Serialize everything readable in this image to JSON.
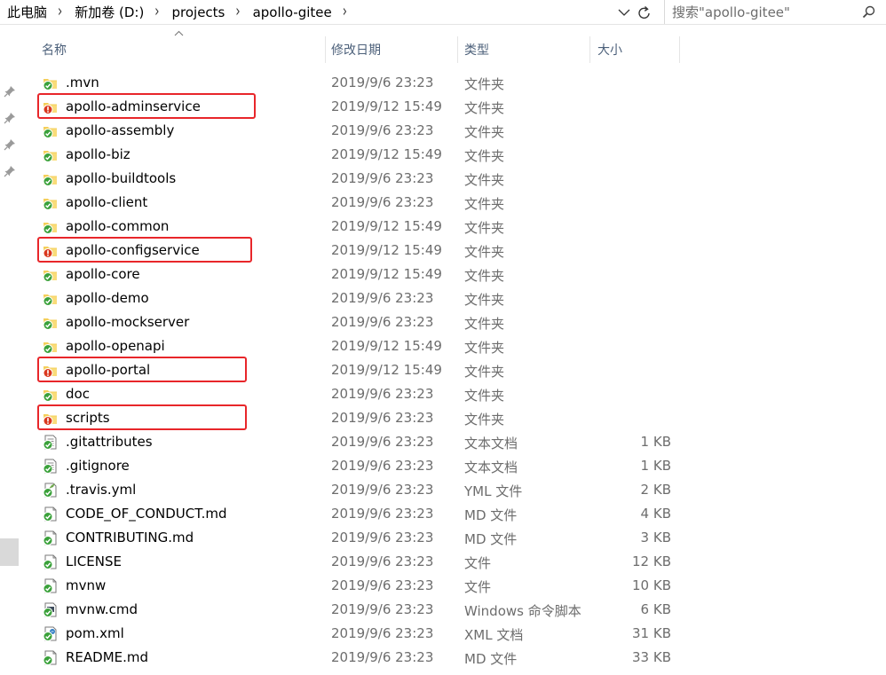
{
  "breadcrumb": [
    "此电脑",
    "新加卷 (D:)",
    "projects",
    "apollo-gitee"
  ],
  "search": {
    "placeholder": "搜索\"apollo-gitee\""
  },
  "columns": {
    "name": "名称",
    "date": "修改日期",
    "type": "类型",
    "size": "大小"
  },
  "colors": {
    "highlight": "#e8262a",
    "conflict": "#d9381e",
    "ok": "#3aa13a",
    "header_text": "#4c607a"
  },
  "rows": [
    {
      "name": ".mvn",
      "date": "2019/9/6 23:23",
      "type": "文件夹",
      "size": "",
      "kind": "folder",
      "status": "ok",
      "highlight": false
    },
    {
      "name": "apollo-adminservice",
      "date": "2019/9/12 15:49",
      "type": "文件夹",
      "size": "",
      "kind": "folder",
      "status": "modified",
      "highlight": true
    },
    {
      "name": "apollo-assembly",
      "date": "2019/9/6 23:23",
      "type": "文件夹",
      "size": "",
      "kind": "folder",
      "status": "ok",
      "highlight": false
    },
    {
      "name": "apollo-biz",
      "date": "2019/9/12 15:49",
      "type": "文件夹",
      "size": "",
      "kind": "folder",
      "status": "ok",
      "highlight": false
    },
    {
      "name": "apollo-buildtools",
      "date": "2019/9/6 23:23",
      "type": "文件夹",
      "size": "",
      "kind": "folder",
      "status": "ok",
      "highlight": false
    },
    {
      "name": "apollo-client",
      "date": "2019/9/6 23:23",
      "type": "文件夹",
      "size": "",
      "kind": "folder",
      "status": "ok",
      "highlight": false
    },
    {
      "name": "apollo-common",
      "date": "2019/9/12 15:49",
      "type": "文件夹",
      "size": "",
      "kind": "folder",
      "status": "ok",
      "highlight": false
    },
    {
      "name": "apollo-configservice",
      "date": "2019/9/12 15:49",
      "type": "文件夹",
      "size": "",
      "kind": "folder",
      "status": "modified",
      "highlight": true
    },
    {
      "name": "apollo-core",
      "date": "2019/9/12 15:49",
      "type": "文件夹",
      "size": "",
      "kind": "folder",
      "status": "ok",
      "highlight": false
    },
    {
      "name": "apollo-demo",
      "date": "2019/9/6 23:23",
      "type": "文件夹",
      "size": "",
      "kind": "folder",
      "status": "ok",
      "highlight": false
    },
    {
      "name": "apollo-mockserver",
      "date": "2019/9/6 23:23",
      "type": "文件夹",
      "size": "",
      "kind": "folder",
      "status": "ok",
      "highlight": false
    },
    {
      "name": "apollo-openapi",
      "date": "2019/9/12 15:49",
      "type": "文件夹",
      "size": "",
      "kind": "folder",
      "status": "ok",
      "highlight": false
    },
    {
      "name": "apollo-portal",
      "date": "2019/9/12 15:49",
      "type": "文件夹",
      "size": "",
      "kind": "folder",
      "status": "modified",
      "highlight": true
    },
    {
      "name": "doc",
      "date": "2019/9/6 23:23",
      "type": "文件夹",
      "size": "",
      "kind": "folder",
      "status": "ok",
      "highlight": false
    },
    {
      "name": "scripts",
      "date": "2019/9/6 23:23",
      "type": "文件夹",
      "size": "",
      "kind": "folder",
      "status": "modified",
      "highlight": true
    },
    {
      "name": ".gitattributes",
      "date": "2019/9/6 23:23",
      "type": "文本文档",
      "size": "1 KB",
      "kind": "text",
      "status": "ok",
      "highlight": false
    },
    {
      "name": ".gitignore",
      "date": "2019/9/6 23:23",
      "type": "文本文档",
      "size": "1 KB",
      "kind": "text",
      "status": "ok",
      "highlight": false
    },
    {
      "name": ".travis.yml",
      "date": "2019/9/6 23:23",
      "type": "YML 文件",
      "size": "2 KB",
      "kind": "yml",
      "status": "ok",
      "highlight": false
    },
    {
      "name": "CODE_OF_CONDUCT.md",
      "date": "2019/9/6 23:23",
      "type": "MD 文件",
      "size": "4 KB",
      "kind": "file",
      "status": "ok",
      "highlight": false
    },
    {
      "name": "CONTRIBUTING.md",
      "date": "2019/9/6 23:23",
      "type": "MD 文件",
      "size": "3 KB",
      "kind": "file",
      "status": "ok",
      "highlight": false
    },
    {
      "name": "LICENSE",
      "date": "2019/9/6 23:23",
      "type": "文件",
      "size": "12 KB",
      "kind": "file",
      "status": "ok",
      "highlight": false
    },
    {
      "name": "mvnw",
      "date": "2019/9/6 23:23",
      "type": "文件",
      "size": "10 KB",
      "kind": "file",
      "status": "ok",
      "highlight": false
    },
    {
      "name": "mvnw.cmd",
      "date": "2019/9/6 23:23",
      "type": "Windows 命令脚本",
      "size": "6 KB",
      "kind": "cmd",
      "status": "ok",
      "highlight": false
    },
    {
      "name": "pom.xml",
      "date": "2019/9/6 23:23",
      "type": "XML 文档",
      "size": "31 KB",
      "kind": "xml",
      "status": "ok",
      "highlight": false
    },
    {
      "name": "README.md",
      "date": "2019/9/6 23:23",
      "type": "MD 文件",
      "size": "33 KB",
      "kind": "file",
      "status": "ok",
      "highlight": false
    }
  ]
}
